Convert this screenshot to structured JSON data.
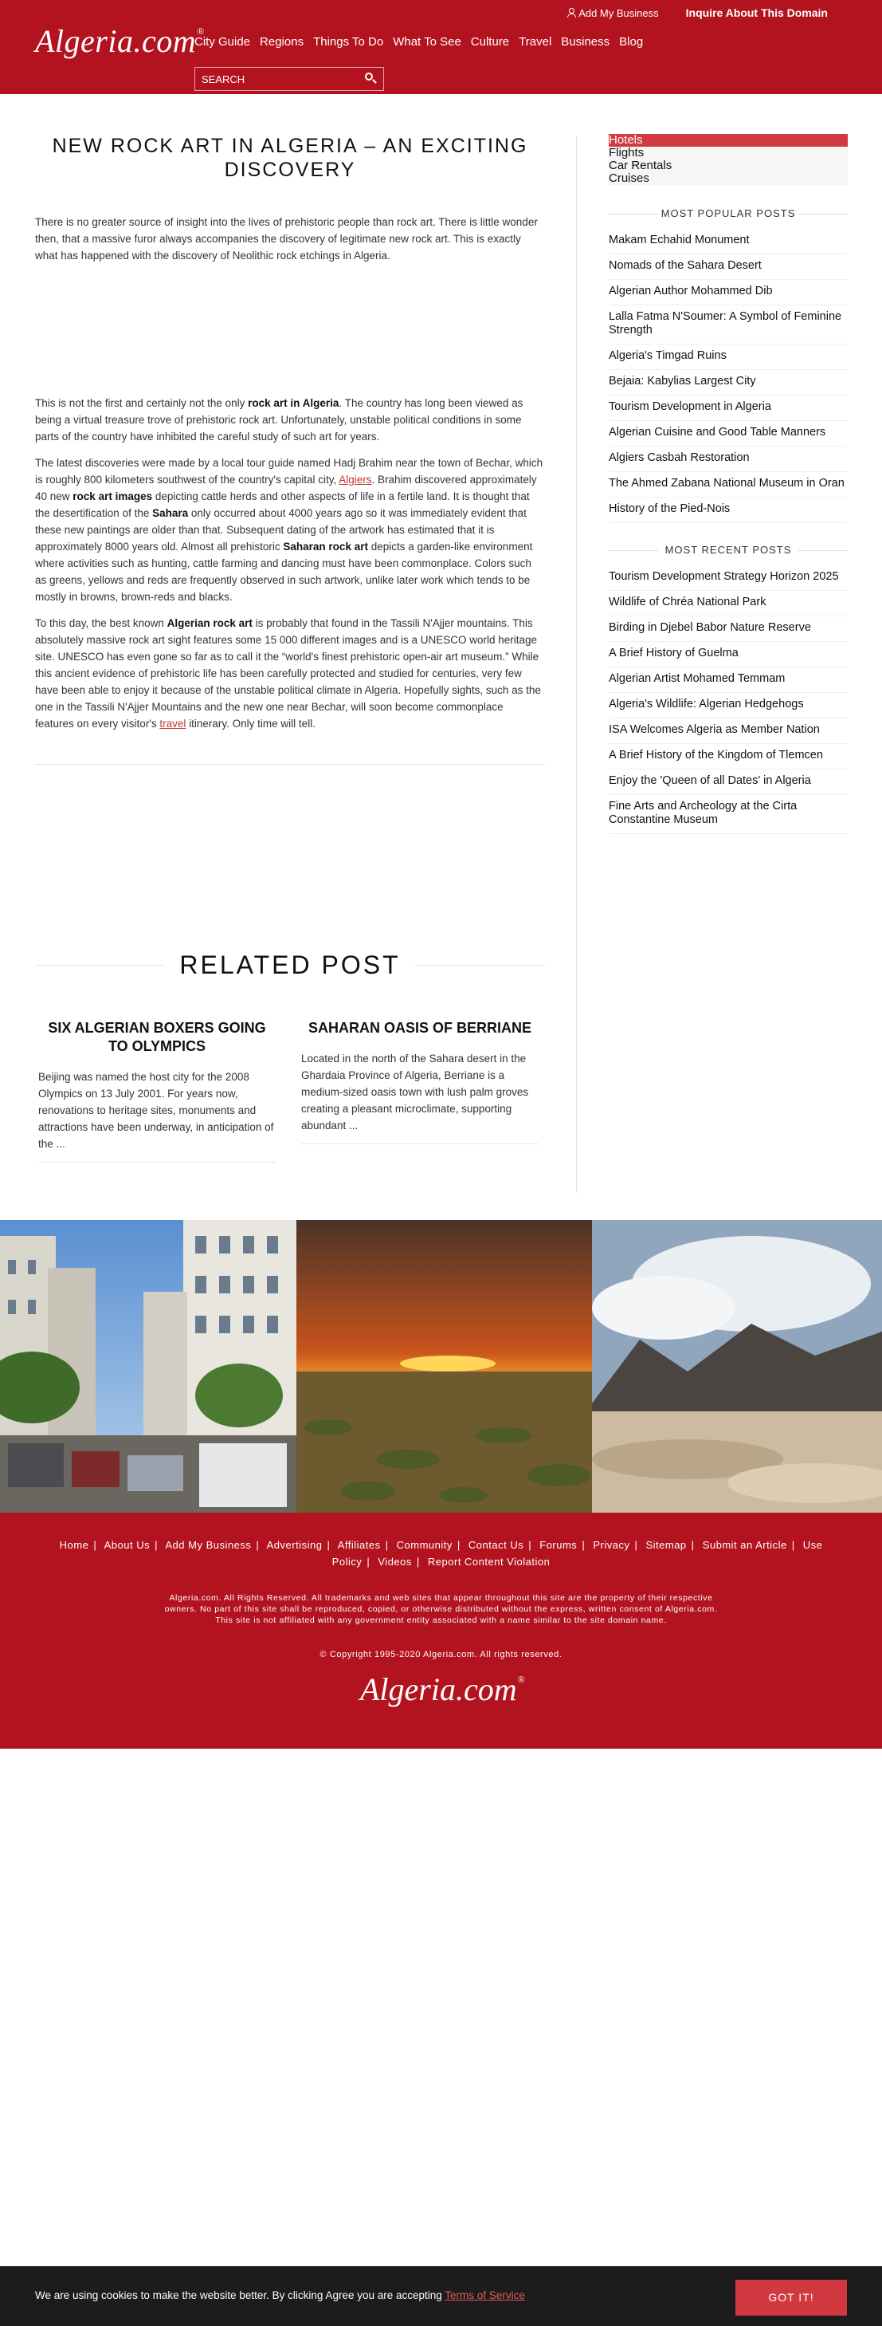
{
  "header": {
    "logo": "Algeria.com",
    "logo_mark": "®",
    "add_business": "Add My Business",
    "inquire": "Inquire About This Domain",
    "nav": [
      "City Guide",
      "Regions",
      "Things To Do",
      "What To See",
      "Culture",
      "Travel",
      "Business",
      "Blog"
    ],
    "search_placeholder": "SEARCH"
  },
  "article": {
    "title": "NEW ROCK ART IN ALGERIA – AN EXCITING DISCOVERY",
    "p1": "There is no greater source of insight into the lives of prehistoric people than rock art. There is little wonder then, that a massive furor always accompanies the discovery of legitimate new rock art. This is exactly what has happened with the discovery of Neolithic rock etchings in Algeria.",
    "p2": {
      "a": "This is not the first and certainly not the only ",
      "b": "rock art in Algeria",
      "c": ". The country has long been viewed as being a virtual treasure trove of prehistoric rock art. Unfortunately, unstable political conditions in some parts of the country have inhibited the careful study of such art for years."
    },
    "p3": {
      "a": "The latest discoveries were made by a local tour guide named Hadj Brahim near the town of Bechar, which is roughly 800 kilometers southwest of the country's capital city, ",
      "link": "Algiers",
      "b": ". Brahim discovered approximately 40 new ",
      "c": "rock art images",
      "d": " depicting cattle herds and other aspects of life in a fertile land. It is thought that the desertification of the ",
      "e": "Sahara",
      "f": " only occurred about 4000 years ago so it was immediately evident that these new paintings are older than that. Subsequent dating of the artwork has estimated that it is approximately 8000 years old. Almost all prehistoric ",
      "g": "Saharan rock art",
      "h": " depicts a garden-like environment where activities such as hunting, cattle farming and dancing must have been commonplace. Colors such as greens, yellows and reds are frequently observed in such artwork, unlike later work which tends to be mostly in browns, brown-reds and blacks."
    },
    "p4": {
      "a": "To this day, the best known ",
      "b": "Algerian rock art",
      "c": " is probably that found in the Tassili N'Ajjer mountains. This absolutely massive rock art sight features some 15 000 different images and is a UNESCO world heritage site. UNESCO has even gone so far as to call it the “world's finest prehistoric open-air art museum.” While this ancient evidence of prehistoric life has been carefully protected and studied for centuries, very few have been able to enjoy it because of the unstable political climate in Algeria. Hopefully sights, such as the one in the Tassili N'Ajjer Mountains and the new one near Bechar, will soon become commonplace features on every visitor's ",
      "link": "travel",
      "d": " itinerary. Only time will tell."
    }
  },
  "sidebar": {
    "categories": [
      "Hotels",
      "Flights",
      "Car Rentals",
      "Cruises"
    ],
    "popular_title": "MOST POPULAR POSTS",
    "popular": [
      "Makam Echahid Monument",
      "Nomads of the Sahara Desert",
      "Algerian Author Mohammed Dib",
      "Lalla Fatma N'Soumer: A Symbol of Feminine Strength",
      "Algeria's Timgad Ruins",
      "Bejaia: Kabylias Largest City",
      "Tourism Development in Algeria",
      "Algerian Cuisine and Good Table Manners",
      "Algiers Casbah Restoration",
      "The Ahmed Zabana National Museum in Oran",
      "History of the Pied-Nois"
    ],
    "recent_title": "MOST RECENT POSTS",
    "recent": [
      "Tourism Development Strategy Horizon 2025",
      "Wildlife of Chréa National Park",
      "Birding in Djebel Babor Nature Reserve",
      "A Brief History of Guelma",
      "Algerian Artist Mohamed Temmam",
      "Algeria's Wildlife: Algerian Hedgehogs",
      "ISA Welcomes Algeria as Member Nation",
      "A Brief History of the Kingdom of Tlemcen",
      "Enjoy the 'Queen of all Dates' in Algeria",
      "Fine Arts and Archeology at the Cirta Constantine Museum"
    ]
  },
  "related": {
    "title": "RELATED POST",
    "posts": [
      {
        "title": "SIX ALGERIAN BOXERS GOING TO OLYMPICS",
        "excerpt": "Beijing was named the host city for the 2008 Olympics on 13 July 2001. For years now, renovations to heritage sites, monuments and attractions have been underway, in anticipation of the ..."
      },
      {
        "title": "SAHARAN OASIS OF BERRIANE",
        "excerpt": "Located in the north of the Sahara desert in the Ghardaia Province of Algeria, Berriane is a medium-sized oasis town with lush palm groves creating a pleasant microclimate, supporting abundant ..."
      }
    ]
  },
  "footer": {
    "links": [
      "Home",
      "About Us",
      "Add My Business",
      "Advertising",
      "Affiliates",
      "Community",
      "Contact Us",
      "Forums",
      "Privacy",
      "Sitemap",
      "Submit an Article",
      "Use Policy",
      "Videos",
      "Report Content Violation"
    ],
    "notice": "Algeria.com. All Rights Reserved. All trademarks and web sites that appear throughout this site are the property of their respective owners. No part of this site shall be reproduced, copied, or otherwise distributed without the express, written consent of Algeria.com. This site is not affiliated with any government entity associated with a name similar to the site domain name.",
    "copyright": "© Copyright 1995-2020 Algeria.com. All rights reserved.",
    "logo": "Algeria.com",
    "logo_mark": "®"
  },
  "cookie": {
    "text": "We are using cookies to make the website better. By clicking Agree you are accepting ",
    "link": "Terms of Service",
    "button": "GOT IT!"
  },
  "colors": {
    "brand_red": "#b3131f",
    "accent_red": "#d13b3f",
    "cookie_bg": "#1c1c1c"
  }
}
